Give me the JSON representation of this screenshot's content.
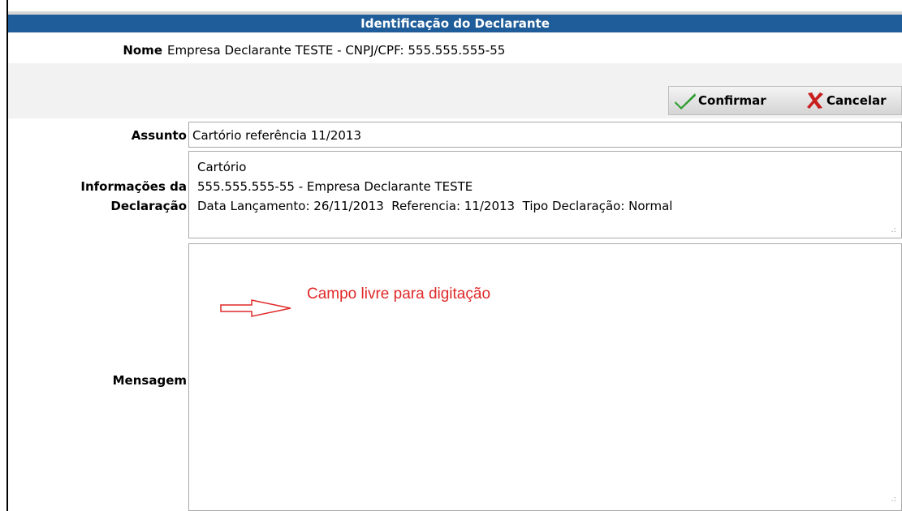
{
  "header": {
    "title": "Identificação do Declarante"
  },
  "declarant": {
    "label": "Nome",
    "value": "Empresa Declarante TESTE - CNPJ/CPF: 555.555.555-55"
  },
  "toolbar": {
    "confirm_label": "Confirmar",
    "cancel_label": "Cancelar"
  },
  "form": {
    "subject": {
      "label": "Assunto",
      "value": "Cartório referência 11/2013"
    },
    "info": {
      "label_line1": "Informações da",
      "label_line2": "Declaração",
      "lines": [
        "Cartório",
        "555.555.555-55 - Empresa Declarante TESTE",
        "Data Lançamento: 26/11/2013  Referencia: 11/2013  Tipo Declaração: Normal"
      ]
    },
    "message": {
      "label": "Mensagem",
      "value": ""
    }
  },
  "annotation": {
    "text": "Campo livre para digitação",
    "color": "#e02828"
  },
  "colors": {
    "header_bg": "#1f5d9a",
    "confirm_icon": "#2e9e2e",
    "cancel_icon": "#c81e1e"
  },
  "icons": {
    "confirm": "checkmark-icon",
    "cancel": "x-icon",
    "annotation": "arrow-right-icon"
  }
}
